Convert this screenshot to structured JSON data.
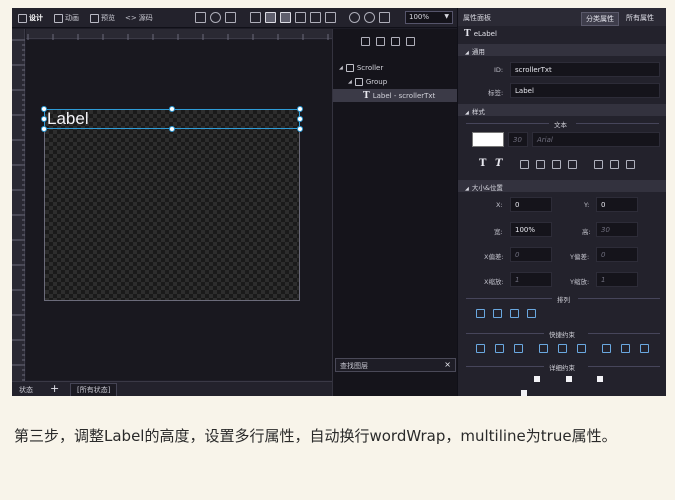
{
  "toolbar": {
    "tabs": [
      {
        "label": "设计",
        "active": true
      },
      {
        "label": "动画",
        "active": false
      },
      {
        "label": "预览",
        "active": false
      },
      {
        "label": "源码",
        "active": false
      }
    ],
    "zoom": "100%"
  },
  "status_bar": {
    "label": "状态",
    "add": "+",
    "all_states": "[所有状态]"
  },
  "layers": {
    "tree": [
      {
        "label": "Scroller"
      },
      {
        "label": "Group"
      },
      {
        "label": "Label - scrollerTxt",
        "selected": true
      }
    ],
    "search_label": "查找图层",
    "search_clear": "×"
  },
  "canvas": {
    "label_text": "Label"
  },
  "properties": {
    "title": "属性面板",
    "category_button": "分类属性",
    "all_button": "所有属性",
    "component": "eLabel",
    "sections": {
      "common": "通用",
      "style": "样式",
      "size_position": "大小&位置"
    },
    "fields": {
      "id_label": "ID:",
      "id_value": "scrollerTxt",
      "tag_label": "标签:",
      "tag_value": "Label",
      "text_group": "文本",
      "font_size_placeholder": "30",
      "font_family_placeholder": "Arial",
      "x_label": "X:",
      "x_value": "0",
      "y_label": "Y:",
      "y_value": "0",
      "width_label": "宽:",
      "width_value": "100%",
      "height_label": "高:",
      "height_placeholder": "30",
      "x_scale_label": "X偏差:",
      "x_scale_placeholder": "0",
      "y_scale_label": "Y偏差:",
      "y_scale_placeholder": "0",
      "x_zoom_label": "X缩放:",
      "x_zoom_placeholder": "1",
      "y_zoom_label": "Y缩放:",
      "y_zoom_placeholder": "1",
      "arrange_group": "排列",
      "quick_layout_group": "快捷约束",
      "detail_layout_group": "详细约束"
    }
  },
  "caption": "第三步，调整Label的高度，设置多行属性，自动换行wordWrap，multiline为true属性。"
}
